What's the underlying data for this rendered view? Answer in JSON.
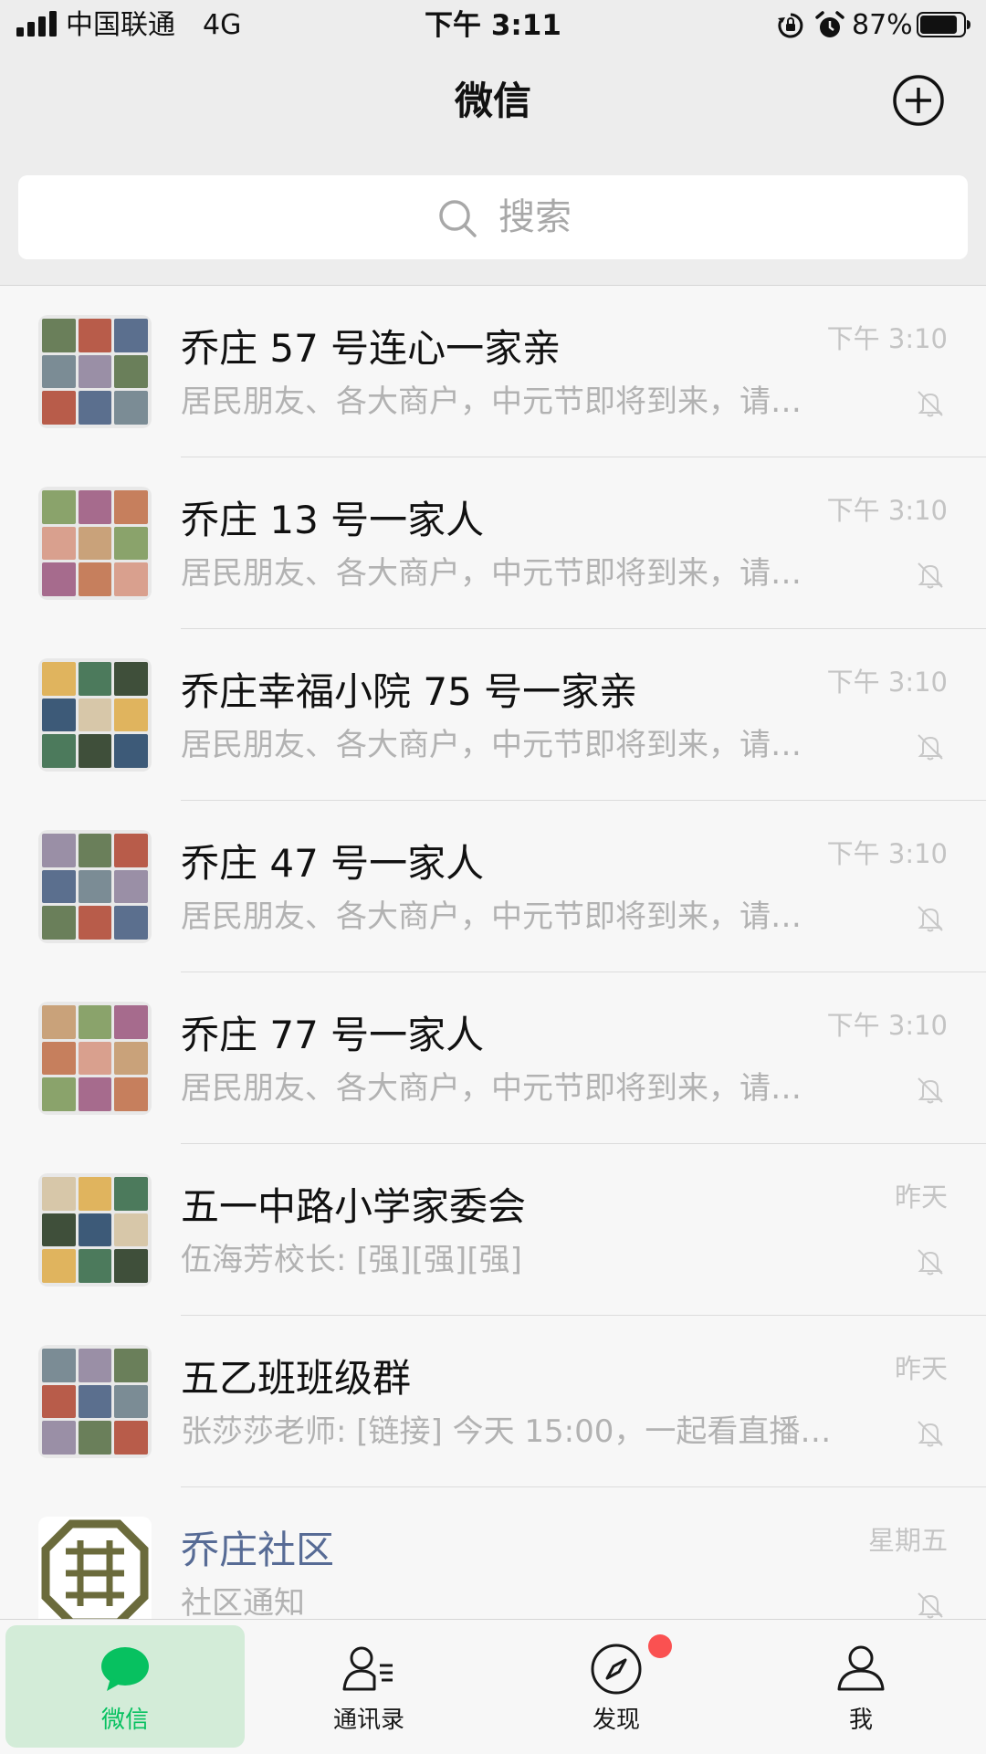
{
  "status_bar": {
    "carrier": "中国联通",
    "network": "4G",
    "time": "下午 3:11",
    "battery": "87%",
    "battery_level": 0.87
  },
  "header": {
    "title": "微信",
    "add_icon": "plus-circle-icon"
  },
  "search": {
    "placeholder": "搜索",
    "icon": "search-icon"
  },
  "chats": [
    {
      "name": "乔庄 57 号连心一家亲",
      "preview": "居民朋友、各大商户，中元节即将到来，请…",
      "time": "下午 3:10",
      "muted": true
    },
    {
      "name": "乔庄 13 号一家人",
      "preview": "居民朋友、各大商户，中元节即将到来，请…",
      "time": "下午 3:10",
      "muted": true
    },
    {
      "name": "乔庄幸福小院 75 号一家亲",
      "preview": "居民朋友、各大商户，中元节即将到来，请…",
      "time": "下午 3:10",
      "muted": true
    },
    {
      "name": "乔庄 47 号一家人",
      "preview": "居民朋友、各大商户，中元节即将到来，请…",
      "time": "下午 3:10",
      "muted": true
    },
    {
      "name": "乔庄 77 号一家人",
      "preview": "居民朋友、各大商户，中元节即将到来，请…",
      "time": "下午 3:10",
      "muted": true
    },
    {
      "name": "五一中路小学家委会",
      "preview": "伍海芳校长: [强][强][强]",
      "time": "昨天",
      "muted": true
    },
    {
      "name": "五乙班班级群",
      "preview": "张莎莎老师: [链接] 今天 15:00，一起看直播…",
      "time": "昨天",
      "muted": true
    },
    {
      "name": "乔庄社区",
      "preview": "社区通知",
      "time": "星期五",
      "muted": true
    }
  ],
  "tabs": [
    {
      "label": "微信",
      "icon": "chat-bubble-icon",
      "active": true
    },
    {
      "label": "通讯录",
      "icon": "contacts-icon",
      "active": false
    },
    {
      "label": "发现",
      "icon": "compass-icon",
      "active": false,
      "badge": true
    },
    {
      "label": "我",
      "icon": "person-icon",
      "active": false
    }
  ],
  "colors": {
    "accent": "#07c160",
    "background": "#ededed",
    "list_bg": "#f7f7f7",
    "badge": "#fa5151",
    "official_name": "#576b95"
  }
}
